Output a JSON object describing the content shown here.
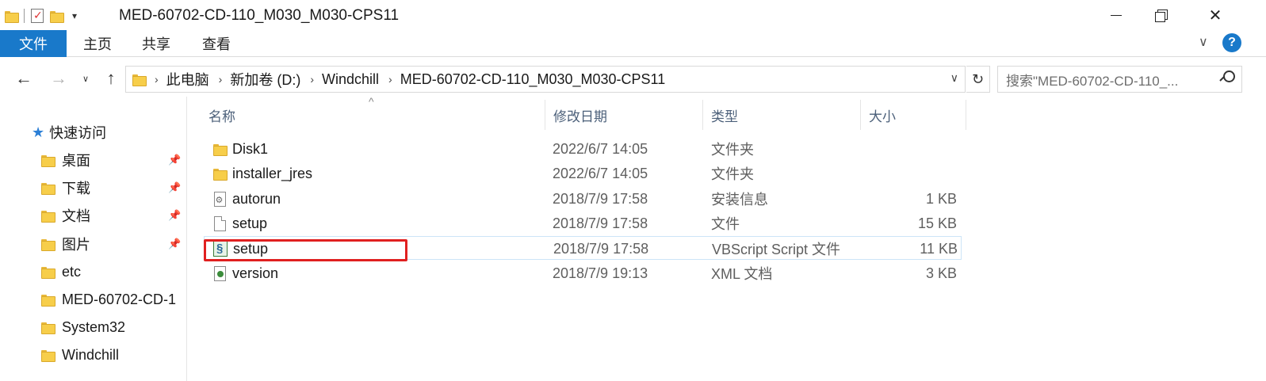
{
  "window": {
    "title": "MED-60702-CD-110_M030_M030-CPS11",
    "qat_dropdown": "▾"
  },
  "ribbon": {
    "tabs": [
      "文件",
      "主页",
      "共享",
      "查看"
    ],
    "collapse": "∨",
    "help": "?"
  },
  "nav": {
    "back": "←",
    "forward": "→",
    "recent": "∨",
    "up": "↑",
    "breadcrumbs": [
      "此电脑",
      "新加卷 (D:)",
      "Windchill",
      "MED-60702-CD-110_M030_M030-CPS11"
    ],
    "crumb_sep": "›",
    "address_dropdown": "∨",
    "refresh": "↻",
    "search_placeholder": "搜索\"MED-60702-CD-110_..."
  },
  "sidebar": {
    "quick_access": "快速访问",
    "items": [
      {
        "label": "桌面",
        "pinned": true
      },
      {
        "label": "下载",
        "pinned": true
      },
      {
        "label": "文档",
        "pinned": true
      },
      {
        "label": "图片",
        "pinned": true
      },
      {
        "label": "etc",
        "pinned": false
      },
      {
        "label": "MED-60702-CD-1",
        "pinned": false
      },
      {
        "label": "System32",
        "pinned": false
      },
      {
        "label": "Windchill",
        "pinned": false
      }
    ],
    "pin_glyph": "📌"
  },
  "columns": {
    "name": "名称",
    "date": "修改日期",
    "type": "类型",
    "size": "大小",
    "sort_glyph": "^"
  },
  "files": [
    {
      "name": "Disk1",
      "date": "2022/6/7 14:05",
      "type": "文件夹",
      "size": "",
      "icon": "folder-icon"
    },
    {
      "name": "installer_jres",
      "date": "2022/6/7 14:05",
      "type": "文件夹",
      "size": "",
      "icon": "folder-icon"
    },
    {
      "name": "autorun",
      "date": "2018/7/9 17:58",
      "type": "安装信息",
      "size": "1 KB",
      "icon": "setup-info-icon"
    },
    {
      "name": "setup",
      "date": "2018/7/9 17:58",
      "type": "文件",
      "size": "15 KB",
      "icon": "file-icon"
    },
    {
      "name": "setup",
      "date": "2018/7/9 17:58",
      "type": "VBScript Script 文件",
      "size": "11 KB",
      "icon": "vbscript-icon"
    },
    {
      "name": "version",
      "date": "2018/7/9 19:13",
      "type": "XML 文档",
      "size": "3 KB",
      "icon": "xml-icon"
    }
  ],
  "colors": {
    "accent": "#1979ca",
    "highlight_box": "#e02020"
  }
}
